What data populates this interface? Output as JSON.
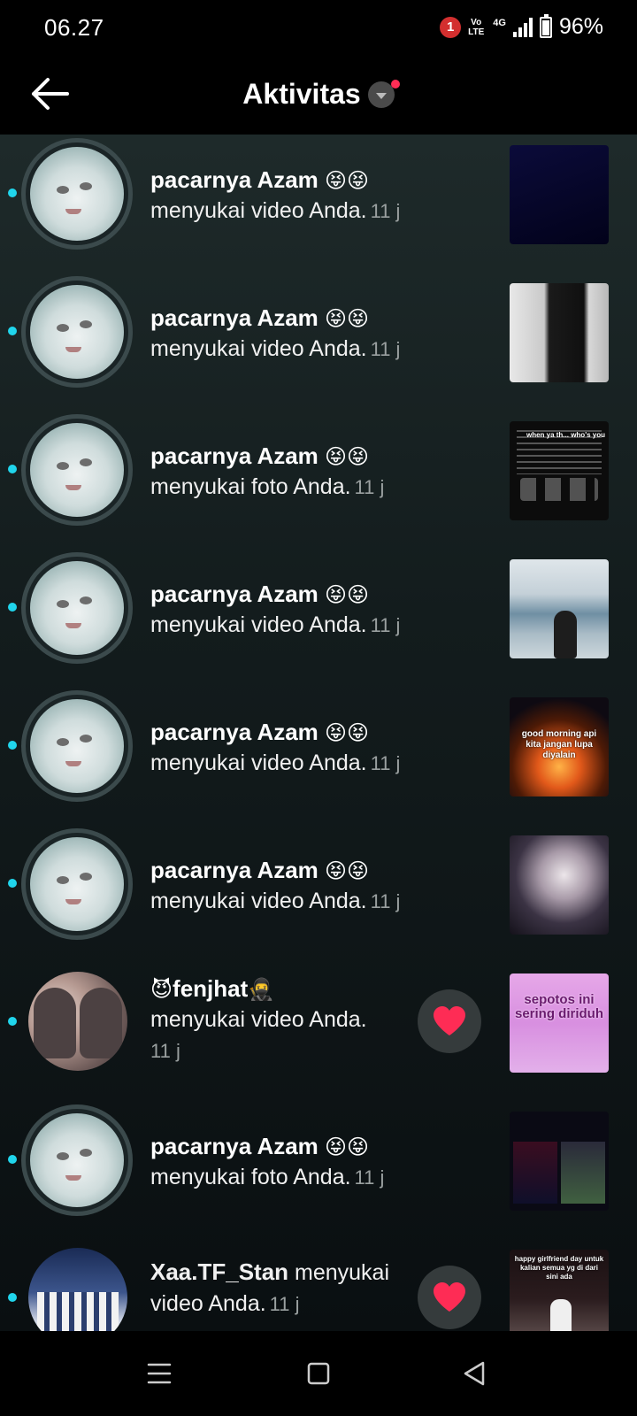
{
  "status_bar": {
    "time": "06.27",
    "notification_count": "1",
    "volte": "Vo LTE",
    "network": "4G",
    "battery": "96%"
  },
  "header": {
    "title": "Aktivitas"
  },
  "activities": [
    {
      "user": "pacarnya Azam",
      "user_emoji": "😝😝",
      "action": "menyukai video Anda.",
      "time": "11 j"
    },
    {
      "user": "pacarnya Azam",
      "user_emoji": "😝😝",
      "action": "menyukai video Anda.",
      "time": "11 j"
    },
    {
      "user": "pacarnya Azam",
      "user_emoji": "😝😝",
      "action": "menyukai foto Anda.",
      "time": "11 j",
      "thumb_text": "when ya th... who's you"
    },
    {
      "user": "pacarnya Azam",
      "user_emoji": "😝😝",
      "action": "menyukai video Anda.",
      "time": "11 j"
    },
    {
      "user": "pacarnya Azam",
      "user_emoji": "😝😝",
      "action": "menyukai video Anda.",
      "time": "11 j",
      "thumb_text": "good morning api kita jangan lupa diyalain"
    },
    {
      "user": "pacarnya Azam",
      "user_emoji": "😝😝",
      "action": "menyukai video Anda.",
      "time": "11 j"
    },
    {
      "user": "fenjhat",
      "user_emoji_prefix": "😈",
      "user_emoji": "🥷",
      "action": "menyukai video Anda.",
      "time": "11 j",
      "thumb_text": "sepotos ini sering diriduh"
    },
    {
      "user": "pacarnya Azam",
      "user_emoji": "😝😝",
      "action": "menyukai foto Anda.",
      "time": "11 j"
    },
    {
      "user": "Xaa.TF_Stan",
      "action_inline": "menyukai",
      "action": "video Anda.",
      "time": "11 j",
      "thumb_text": "happy girlfriend day untuk kalian semua yg di dari sini ada"
    }
  ],
  "icons": {
    "back": "arrow-left-icon",
    "dropdown": "chevron-down-icon",
    "like": "heart-icon",
    "nav_menu": "menu-icon",
    "nav_home": "square-icon",
    "nav_back": "triangle-back-icon"
  },
  "colors": {
    "unread_dot": "#20d5ec",
    "heart": "#fe2c55",
    "badge": "#d32f2f"
  }
}
